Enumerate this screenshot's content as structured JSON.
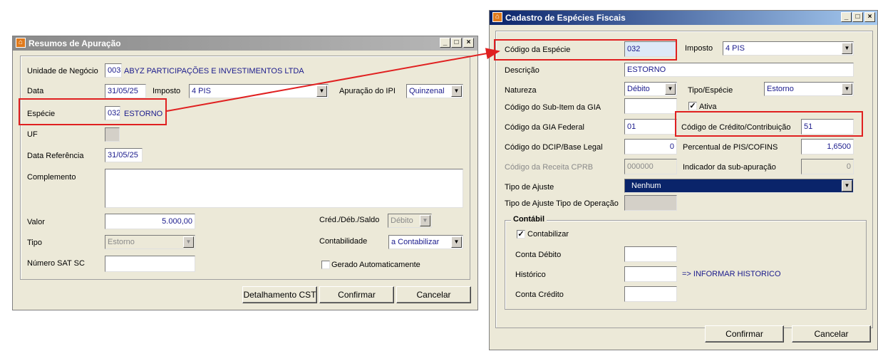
{
  "left_window": {
    "title": "Resumos de Apuração",
    "fields": {
      "unidade_label": "Unidade de Negócio",
      "unidade_code": "003",
      "unidade_name": "ABYZ PARTICIPAÇÕES E INVESTIMENTOS LTDA",
      "data_label": "Data",
      "data_value": "31/05/25",
      "imposto_label": "Imposto",
      "imposto_value": "4 PIS",
      "apuracao_label": "Apuração do IPI",
      "apuracao_value": "Quinzenal",
      "especie_label": "Espécie",
      "especie_code": "032",
      "especie_name": "ESTORNO",
      "uf_label": "UF",
      "data_ref_label": "Data Referência",
      "data_ref_value": "31/05/25",
      "complemento_label": "Complemento",
      "valor_label": "Valor",
      "valor_value": "5.000,00",
      "cred_label": "Créd./Déb./Saldo",
      "cred_value": "Débito",
      "tipo_label": "Tipo",
      "tipo_value": "Estorno",
      "contabilidade_label": "Contabilidade",
      "contabilidade_value": "a Contabilizar",
      "sat_label": "Número SAT SC",
      "gerado_label": "Gerado Automaticamente"
    },
    "buttons": {
      "detalhamento": "Detalhamento CST",
      "confirmar": "Confirmar",
      "cancelar": "Cancelar"
    }
  },
  "right_window": {
    "title": "Cadastro de Espécies Fiscais",
    "fields": {
      "codigo_especie_label": "Código da Espécie",
      "codigo_especie_value": "032",
      "imposto_label": "Imposto",
      "imposto_value": "4 PIS",
      "descricao_label": "Descrição",
      "descricao_value": "ESTORNO",
      "natureza_label": "Natureza",
      "natureza_value": "Débito",
      "tipo_especie_label": "Tipo/Espécie",
      "tipo_especie_value": "Estorno",
      "sub_item_label": "Código do Sub-Item da GIA",
      "ativa_label": "Ativa",
      "gia_federal_label": "Código da GIA Federal",
      "gia_federal_value": "01",
      "credito_label": "Código de Crédito/Contribuição",
      "credito_value": "51",
      "dcip_label": "Código do DCIP/Base Legal",
      "dcip_value": "0",
      "percentual_label": "Percentual de PIS/COFINS",
      "percentual_value": "1,6500",
      "receita_label": "Código da Receita CPRB",
      "receita_value": "000000",
      "indicador_label": "Indicador da sub-apuração",
      "indicador_value": "0",
      "tipo_ajuste_label": "Tipo de Ajuste",
      "tipo_ajuste_value": "Nenhum",
      "tipo_ajuste_op_label": "Tipo de Ajuste Tipo de Operação"
    },
    "contabil": {
      "title": "Contábil",
      "contabilizar_label": "Contabilizar",
      "conta_debito_label": "Conta Débito",
      "historico_label": "Histórico",
      "historico_note": "=> INFORMAR HISTORICO",
      "conta_credito_label": "Conta Crédito"
    },
    "buttons": {
      "confirmar": "Confirmar",
      "cancelar": "Cancelar"
    }
  },
  "annotation_color": "#e02020"
}
